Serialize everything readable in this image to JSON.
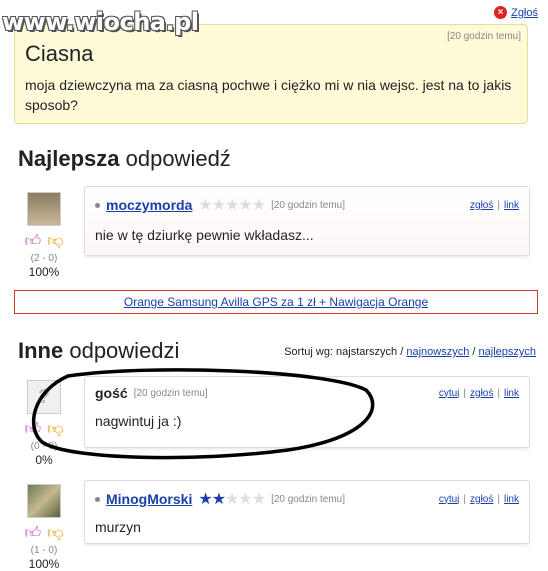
{
  "watermark": "www.wiocha.pl",
  "report_link": "Zgłoś",
  "question": {
    "time": "[20 godzin temu]",
    "title": "Ciasna",
    "body": "moja dziewczyna ma za ciasną pochwe i ciężko mi w nia wejsc. jest na to jakis sposob?"
  },
  "best": {
    "heading_bold": "Najlepsza",
    "heading_rest": " odpowiedź",
    "user": "moczymorda",
    "stars_on": 0,
    "time": "[20 godzin temu]",
    "links": [
      "zgłoś",
      "link"
    ],
    "body": "nie w tę dziurkę pewnie wkładasz...",
    "votes": "(2 - 0)",
    "percent": "100%"
  },
  "ad_text": "Orange Samsung Avilla GPS za 1 zł + Nawigacja Orange",
  "others": {
    "heading_bold": "Inne",
    "heading_rest": " odpowiedzi",
    "sort_label": "Sortuj wg: najstarszych / ",
    "sort_newest": "najnowszych",
    "sort_sep": " / ",
    "sort_best": "najlepszych",
    "answers": [
      {
        "user": "gość",
        "time": "[20 godzin temu]",
        "links": [
          "cytuj",
          "zgłoś",
          "link"
        ],
        "body": "nagwintuj ja :)",
        "votes": "(0 - 0)",
        "percent": "0%"
      },
      {
        "user": "MinogMorski",
        "stars_on": 2,
        "time": "[20 godzin temu]",
        "links": [
          "cytuj",
          "zgłoś",
          "link"
        ],
        "body": "murzyn",
        "votes": "(1 - 0)",
        "percent": "100%"
      }
    ]
  },
  "colors": {
    "accent_link": "#1a3fa8",
    "question_bg": "#fffbd9",
    "ad_border": "#d33"
  }
}
